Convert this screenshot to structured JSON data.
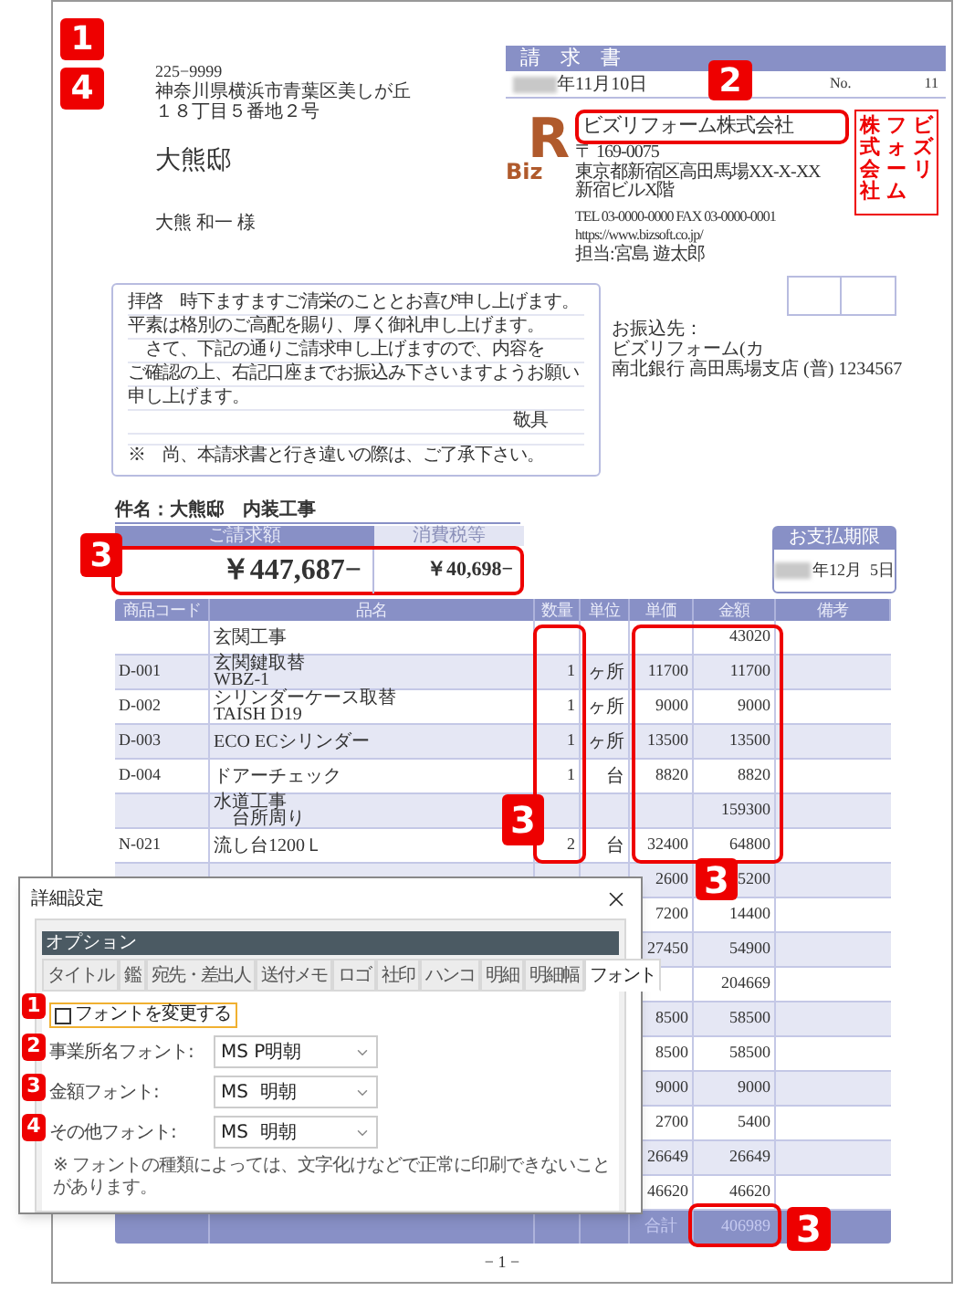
{
  "recipient": {
    "postal_code": "225−9999",
    "address_lines": [
      "神奈川県横浜市青葉区美しが丘",
      "１８丁目５番地２号"
    ],
    "building": "大熊邸",
    "name": "大熊 和一 様"
  },
  "invoice": {
    "title": "請　求　書",
    "date": "年11月10日",
    "no_label": "No.",
    "no": "11"
  },
  "logo": {
    "text": "Biz",
    "mark": "R"
  },
  "company": {
    "name": "ビズリフォーム株式会社",
    "lines": [
      "〒 169-0075",
      "東京都新宿区高田馬場XX-X-XX",
      "新宿ビルX階",
      "TEL 03-0000-0000  FAX 03-0000-0001",
      "https://www.bizsoft.co.jp/",
      "担当:宮島 遊太郎"
    ]
  },
  "stamp": {
    "columns": [
      "株式会社",
      "フォーム",
      "ビズリ"
    ]
  },
  "letter": {
    "lines": [
      "拝啓　時下ますますご清栄のこととお喜び申し上げます。",
      "平素は格別のご高配を賜り、厚く御礼申し上げます。",
      "　さて、下記の通りご請求申し上げますので、内容を",
      "ご確認の上、右記口座までお振込み下さいますようお願い",
      "申し上げます。"
    ],
    "closing": "敬具",
    "note": "※　尚、本請求書と行き違いの際は、ご了承下さい。"
  },
  "bank": {
    "lines": [
      "お振込先：",
      "ビズリフォーム(カ",
      "南北銀行 高田馬場支店 (普) 1234567"
    ]
  },
  "subject": "件名：大熊邸　内装工事",
  "amount": {
    "label": "ご請求額",
    "value": "￥447,687−",
    "tax_label": "消費税等",
    "tax_value": "￥40,698−"
  },
  "due": {
    "label": "お支払期限",
    "date": "年12月  5日"
  },
  "table": {
    "columns": [
      "商品コード",
      "品名",
      "数量",
      "単位",
      "単価",
      "金額",
      "備考"
    ],
    "rows": [
      {
        "name": [
          "玄関工事"
        ],
        "amount": "43020"
      },
      {
        "code": "D-001",
        "name": [
          "玄関鍵取替",
          "WBZ-1"
        ],
        "qty": "1",
        "unit": "ヶ所",
        "price": "11700",
        "amount": "11700"
      },
      {
        "code": "D-002",
        "name": [
          "シリンダーケース取替",
          "TAISH D19"
        ],
        "qty": "1",
        "unit": "ヶ所",
        "price": "9000",
        "amount": "9000"
      },
      {
        "code": "D-003",
        "name": [
          "ECO ECシリンダー"
        ],
        "qty": "1",
        "unit": "ヶ所",
        "price": "13500",
        "amount": "13500"
      },
      {
        "code": "D-004",
        "name": [
          "ドアーチェック"
        ],
        "qty": "1",
        "unit": "台",
        "price": "8820",
        "amount": "8820"
      },
      {
        "name": [
          "水道工事",
          "　台所周り"
        ],
        "amount": "159300"
      },
      {
        "code": "N-021",
        "name": [
          "流し台1200Ｌ"
        ],
        "qty": "2",
        "unit": "台",
        "price": "32400",
        "amount": "64800"
      },
      {
        "price": "2600",
        "amount": "5200"
      },
      {
        "price": "7200",
        "amount": "14400"
      },
      {
        "price": "27450",
        "amount": "54900"
      },
      {
        "amount": "204669"
      },
      {
        "price": "8500",
        "amount": "58500"
      },
      {
        "price": "8500",
        "amount": "58500"
      },
      {
        "price": "9000",
        "amount": "9000"
      },
      {
        "price": "2700",
        "amount": "5400"
      },
      {
        "price": "26649",
        "amount": "26649"
      },
      {
        "price": "46620",
        "amount": "46620"
      }
    ],
    "total_label": "合計",
    "total": "406989"
  },
  "page_number": "− 1 −",
  "callouts": [
    {
      "number": "1"
    },
    {
      "number": "4"
    },
    {
      "number": "2"
    },
    {
      "number": "3"
    },
    {
      "number": "3"
    },
    {
      "number": "3"
    },
    {
      "number": "3"
    }
  ],
  "dialog": {
    "title": "詳細設定",
    "section": "オプション",
    "tabs": [
      {
        "label": "タイトル",
        "selected": false
      },
      {
        "label": "鑑",
        "selected": false
      },
      {
        "label": "宛先・差出人",
        "selected": false
      },
      {
        "label": "送付メモ",
        "selected": false
      },
      {
        "label": "ロゴ",
        "selected": false
      },
      {
        "label": "社印",
        "selected": false
      },
      {
        "label": "ハンコ",
        "selected": false
      },
      {
        "label": "明細",
        "selected": false
      },
      {
        "label": "明細幅",
        "selected": false
      },
      {
        "label": "フォント",
        "selected": true
      }
    ],
    "checkbox": {
      "callout": "1",
      "label": "フォントを変更する",
      "checked": false
    },
    "fields": [
      {
        "callout": "2",
        "label": "事業所名フォント:",
        "value": "MS P明朝"
      },
      {
        "callout": "3",
        "label": "金額フォント:",
        "value": "MS  明朝"
      },
      {
        "callout": "4",
        "label": "その他フォント:",
        "value": "MS  明朝"
      }
    ],
    "note": "※ フォントの種類によっては、文字化けなどで正常に印刷できないことがあります。"
  }
}
